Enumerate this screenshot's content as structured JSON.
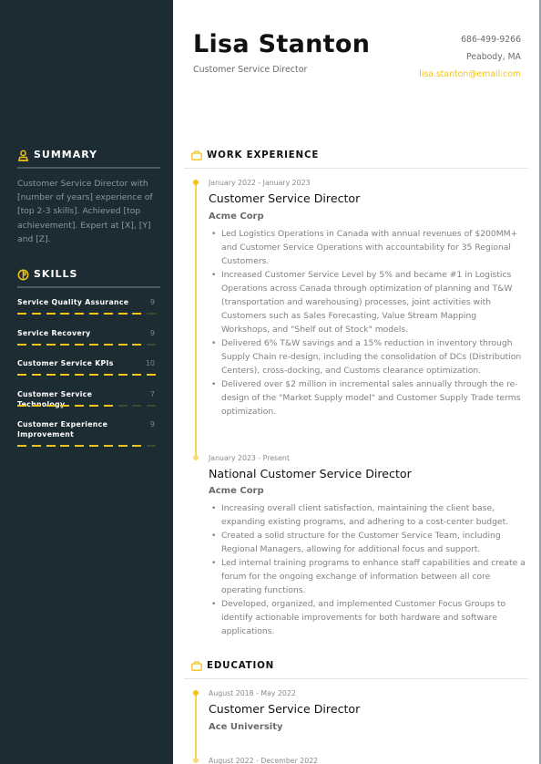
{
  "header": {
    "name": "Lisa Stanton",
    "role": "Customer Service Director",
    "phone": "686-499-9266",
    "location": "Peabody, MA",
    "email": "lisa.stanton@email.com"
  },
  "colors": {
    "sidebar_bg": "#1d2b33",
    "accent": "#f0c419",
    "skill_inactive": "#3f4a35"
  },
  "sidebar": {
    "summary": {
      "icon": "user-icon",
      "title": "SUMMARY",
      "text": "Customer Service Director with [number of years] experience of [top 2-3 skills]. Achieved [top achievement]. Expert at [X], [Y] and [Z]."
    },
    "skills": {
      "icon": "skills-icon",
      "title": "SKILLS",
      "max_level": 10,
      "items": [
        {
          "name": "Service Quality Assurance",
          "level": "9",
          "value": 9
        },
        {
          "name": "Service Recovery",
          "level": "9",
          "value": 9
        },
        {
          "name": "Customer Service KPIs",
          "level": "10",
          "value": 10
        },
        {
          "name": "Customer Service Technology",
          "level": "7",
          "value": 7
        },
        {
          "name": "Customer Experience Improvement",
          "level": "9",
          "value": 9
        }
      ]
    }
  },
  "work": {
    "icon": "briefcase-icon",
    "title": "WORK EXPERIENCE",
    "entries": [
      {
        "date": "January 2022 - January 2023",
        "title": "Customer Service Director",
        "org": "Acme Corp",
        "bullets": [
          "Led Logistics Operations in Canada with annual revenues of $200MM+ and Customer Service Operations with accountability for 35 Regional Customers.",
          "Increased Customer Service Level by 5% and became #1 in Logistics Operations across Canada through optimization of planning and T&W (transportation and warehousing) processes, joint activities with Customers such as Sales Forecasting, Value Stream Mapping Workshops, and \"Shelf out of Stock\" models.",
          "Delivered 6% T&W savings and a 15% reduction in inventory through Supply Chain re-design, including the consolidation of DCs (Distribution Centers), cross-docking, and Customs clearance optimization.",
          "Delivered over $2 million in incremental sales annually through the re-design of the \"Market Supply model\" and Customer Supply Trade terms optimization."
        ]
      },
      {
        "date": "January 2023 - Present",
        "title": "National Customer Service Director",
        "org": "Acme Corp",
        "bullets": [
          "Increasing overall client satisfaction, maintaining the client base, expanding existing programs, and adhering to a cost-center budget.",
          "Created a solid structure for the Customer Service Team, including Regional Managers, allowing for additional focus and support.",
          "Led internal training programs to enhance staff capabilities and create a forum for the ongoing exchange of information between all core operating functions.",
          "Developed, organized, and implemented Customer Focus Groups to identify actionable improvements for both hardware and software applications."
        ]
      }
    ]
  },
  "education": {
    "icon": "briefcase-icon",
    "title": "EDUCATION",
    "entries": [
      {
        "date": "August 2018 - May 2022",
        "title": "Customer Service Director",
        "org": "Ace University"
      },
      {
        "date": "August 2022 - December 2022"
      }
    ]
  }
}
